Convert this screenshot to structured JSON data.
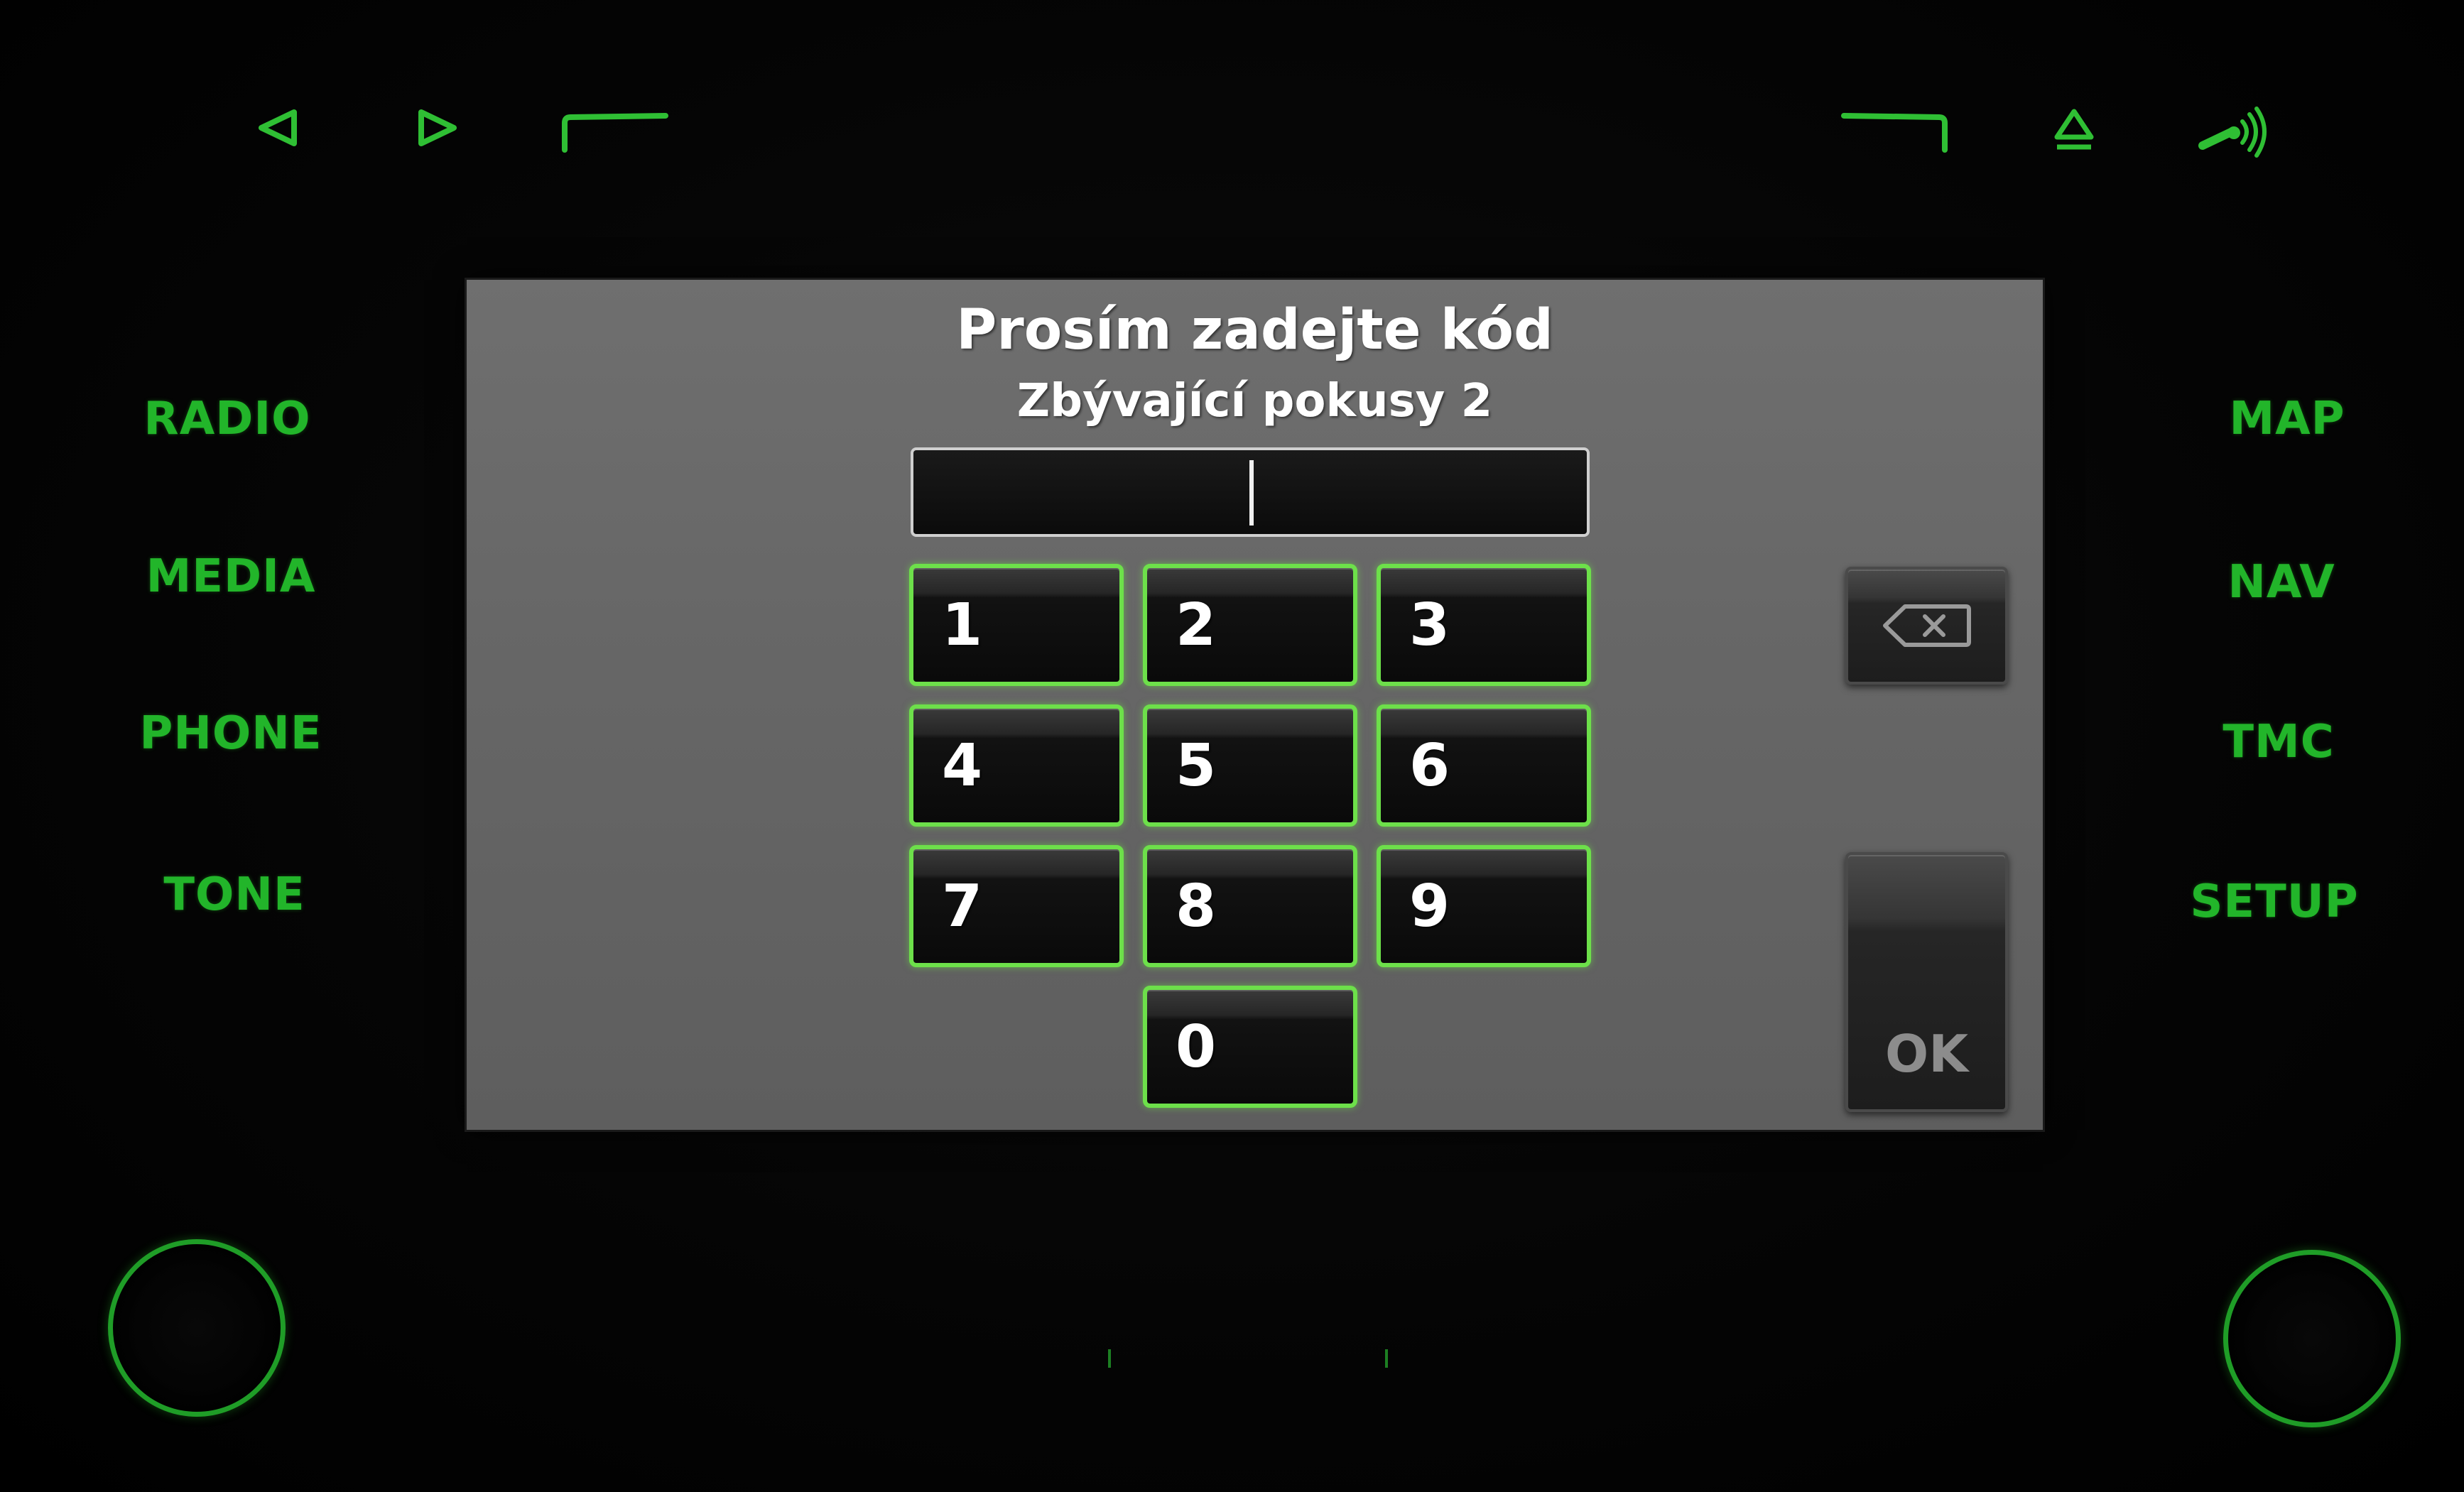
{
  "top_buttons": {
    "prev": "prev-arrow",
    "next": "next-arrow",
    "left_softkey": "softkey-left",
    "right_softkey": "softkey-right",
    "eject": "eject",
    "voice": "voice-command"
  },
  "left_menu": {
    "items": [
      {
        "label": "RADIO"
      },
      {
        "label": "MEDIA"
      },
      {
        "label": "PHONE"
      },
      {
        "label": "TONE"
      }
    ]
  },
  "right_menu": {
    "items": [
      {
        "label": "MAP"
      },
      {
        "label": "NAV"
      },
      {
        "label": "TMC"
      },
      {
        "label": "SETUP"
      }
    ]
  },
  "dialog": {
    "title": "Prosím zadejte kód",
    "subtitle": "Zbývající pokusy 2",
    "code_value": "",
    "keys": [
      "1",
      "2",
      "3",
      "4",
      "5",
      "6",
      "7",
      "8",
      "9",
      "0"
    ],
    "backspace_icon": "backspace-icon",
    "ok_label": "OK"
  },
  "colors": {
    "hardware_green": "#22b52a",
    "key_border_green": "#6de04a",
    "screen_gray": "#676767"
  }
}
